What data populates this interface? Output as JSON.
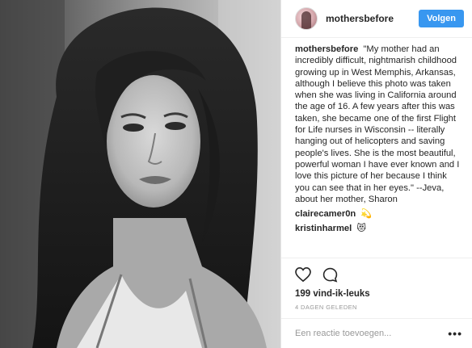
{
  "post": {
    "username": "mothersbefore",
    "follow_label": "Volgen",
    "photo_alt": "",
    "comments": [
      {
        "user": "mothersbefore",
        "text": "\"My mother had an incredibly difficult, nightmarish childhood growing up in West Memphis, Arkansas, although I believe this photo was taken when she was living in California around the age of 16. A few years after this was taken, she became one of the first Flight for Life nurses in Wisconsin -- literally hanging out of helicopters and saving people's lives. She is the most beautiful, powerful woman I have ever known and I love this picture of her because I think you can see that in her eyes.\" --Jeva, about her mother, Sharon"
      },
      {
        "user": "clairecamer0n",
        "text": "💫"
      },
      {
        "user": "kristinharmel",
        "text": "😻"
      }
    ],
    "likes": "199 vind-ik-leuks",
    "timestamp": "4 DAGEN GELEDEN",
    "comment_placeholder": "Een reactie toevoegen...",
    "more_label": "•••"
  },
  "icons": {
    "like": "heart-icon",
    "comment": "speech-bubble-icon",
    "more": "ellipsis-icon"
  },
  "colors": {
    "follow_button": "#3897f0",
    "text": "#262626",
    "muted": "#999999"
  }
}
